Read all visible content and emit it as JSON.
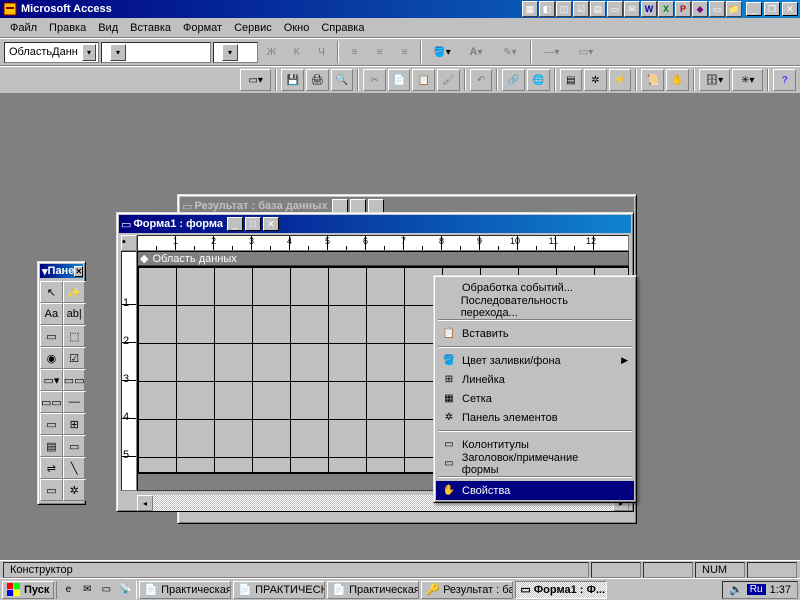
{
  "app": {
    "title": "Microsoft Access"
  },
  "menubar": [
    "Файл",
    "Правка",
    "Вид",
    "Вставка",
    "Формат",
    "Сервис",
    "Окно",
    "Справка"
  ],
  "menubar_underline": [
    0,
    0,
    0,
    2,
    1,
    0,
    0,
    1
  ],
  "toolbar1": {
    "object_combo": "ОбластьДанн",
    "font_combo": "",
    "size_combo": "",
    "bold": "Ж",
    "italic": "К",
    "underline": "Ч"
  },
  "toolbox": {
    "title": "Пане",
    "tools": [
      "↖",
      "✨",
      "Aa",
      "ab|",
      "▭",
      "⬚",
      "◉",
      "☑",
      "▭▾",
      "▭▭",
      "▭▭",
      "—",
      "▭",
      "⊞",
      "▤",
      "▭",
      "⇌",
      "╲",
      "▭",
      "✲"
    ]
  },
  "db_window": {
    "title": "Результат : база данных"
  },
  "form_window": {
    "title": "Форма1 : форма",
    "section": "Область данных"
  },
  "context_menu": {
    "items": [
      {
        "icon": "",
        "label": "Обработка событий..."
      },
      {
        "icon": "",
        "label": "Последовательность перехода..."
      },
      {
        "sep": true
      },
      {
        "icon": "📋",
        "label": "Вставить"
      },
      {
        "sep": true
      },
      {
        "icon": "🪣",
        "label": "Цвет заливки/фона",
        "submenu": true
      },
      {
        "icon": "⊞",
        "label": "Линейка"
      },
      {
        "icon": "▦",
        "label": "Сетка"
      },
      {
        "icon": "✲",
        "label": "Панель элементов"
      },
      {
        "sep": true
      },
      {
        "icon": "▭",
        "label": "Колонтитулы"
      },
      {
        "icon": "▭",
        "label": "Заголовок/примечание формы"
      },
      {
        "sep": true
      },
      {
        "icon": "✋",
        "label": "Свойства",
        "highlighted": true
      }
    ]
  },
  "statusbar": {
    "mode": "Конструктор",
    "num": "NUM"
  },
  "taskbar": {
    "start": "Пуск",
    "tasks": [
      {
        "icon": "📄",
        "label": "Практическая..."
      },
      {
        "icon": "📄",
        "label": "ПРАКТИЧЕСК..."
      },
      {
        "icon": "📄",
        "label": "Практическая..."
      },
      {
        "icon": "🔑",
        "label": "Результат : ба..."
      },
      {
        "icon": "▭",
        "label": "Форма1 : Ф...",
        "active": true
      }
    ],
    "lang": "Ru",
    "time": "1:37"
  }
}
